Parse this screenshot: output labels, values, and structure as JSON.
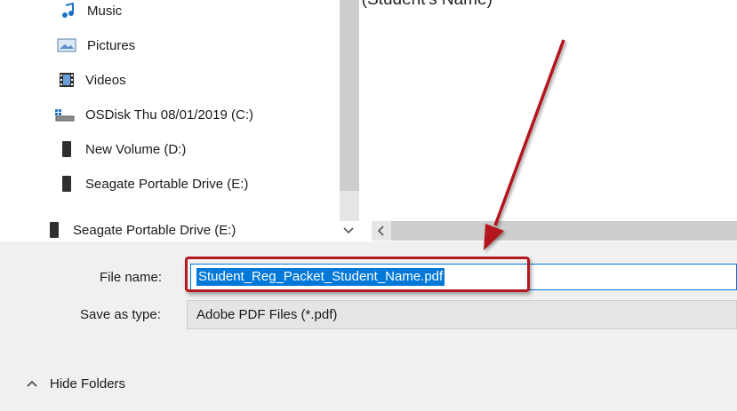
{
  "window": {
    "caption_fragment": "_Reg_Packet_Student_Name (Student's Name)"
  },
  "nav": {
    "items": [
      {
        "label": "Music",
        "icon": "music-icon"
      },
      {
        "label": "Pictures",
        "icon": "pictures-icon"
      },
      {
        "label": "Videos",
        "icon": "videos-icon"
      },
      {
        "label": "OSDisk Thu 08/01/2019 (C:)",
        "icon": "os-disk-icon"
      },
      {
        "label": "New Volume (D:)",
        "icon": "drive-icon"
      },
      {
        "label": "Seagate Portable Drive (E:)",
        "icon": "drive-icon"
      },
      {
        "label": "Seagate Portable Drive (E:)",
        "icon": "drive-icon"
      }
    ]
  },
  "form": {
    "file_name_label": "File name:",
    "file_name_value": "Student_Reg_Packet_Student_Name.pdf",
    "save_type_label": "Save as type:",
    "save_type_value": "Adobe PDF Files (*.pdf)"
  },
  "footer": {
    "hide_folders_label": "Hide Folders"
  },
  "colors": {
    "selection": "#0078d7",
    "annotation": "#b3191e"
  }
}
